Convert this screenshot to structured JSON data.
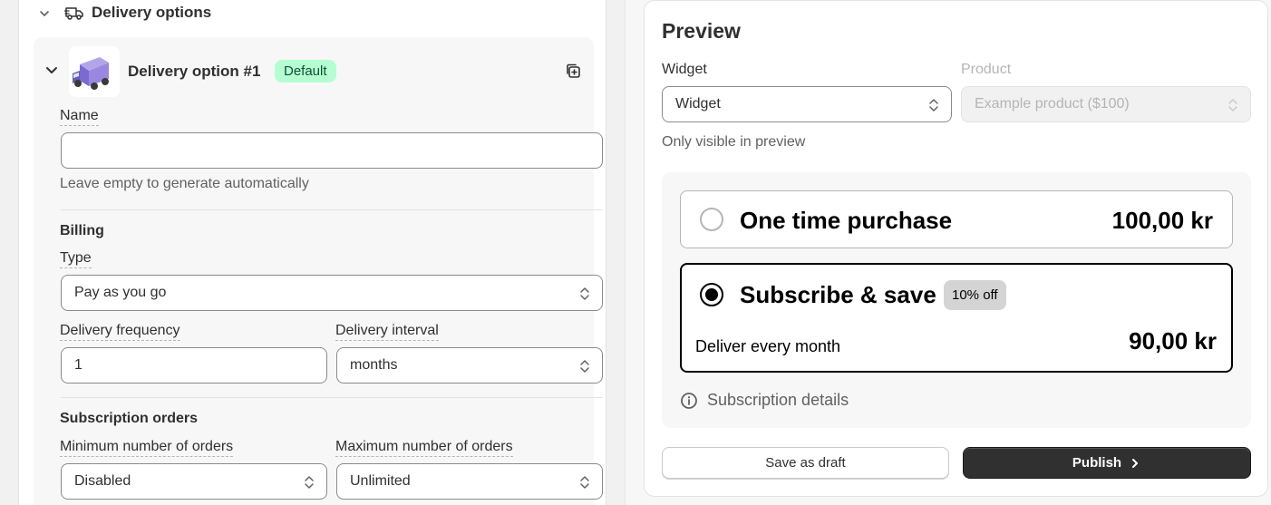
{
  "section": {
    "title": "Delivery options"
  },
  "delivery_option": {
    "title": "Delivery option #1",
    "badge": "Default",
    "name_label": "Name",
    "name_value": "",
    "name_help": "Leave empty to generate automatically",
    "billing_heading": "Billing",
    "type_label": "Type",
    "type_value": "Pay as you go",
    "frequency_label": "Delivery frequency",
    "frequency_value": "1",
    "interval_label": "Delivery interval",
    "interval_value": "months",
    "orders_heading": "Subscription orders",
    "min_orders_label": "Minimum number of orders",
    "min_orders_value": "Disabled",
    "max_orders_label": "Maximum number of orders",
    "max_orders_value": "Unlimited"
  },
  "preview": {
    "title": "Preview",
    "widget_label": "Widget",
    "widget_value": "Widget",
    "product_label": "Product",
    "product_value": "Example product ($100)",
    "visibility_note": "Only visible in preview",
    "one_time": {
      "label": "One time purchase",
      "price": "100,00 kr",
      "selected": false
    },
    "subscribe": {
      "label": "Subscribe & save",
      "discount": "10% off",
      "delivery": "Deliver every month",
      "price": "90,00 kr",
      "selected": true
    },
    "details_link": "Subscription details"
  },
  "actions": {
    "draft_label": "Save as draft",
    "publish_label": "Publish"
  },
  "colors": {
    "default_badge_bg": "#b4fed2",
    "publish_bg": "#303030",
    "selected_border": "#000000"
  }
}
